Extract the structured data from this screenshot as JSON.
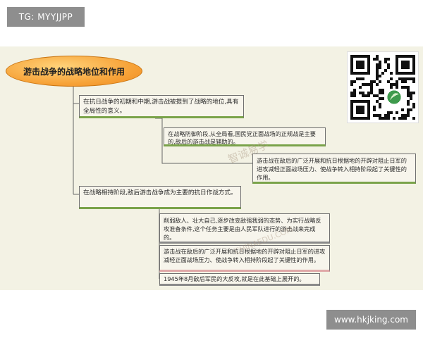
{
  "tags": {
    "top": "TG: MYYJJPP",
    "bottom": "www.hkjking.com"
  },
  "diagram": {
    "title": "游击战争的战略地位和作用",
    "nodes": [
      {
        "text": "在抗日战争的初期和中期,游击战被提到了战略的地位,具有全局性的意义。"
      },
      {
        "text": "在战略防御阶段,从全局看,国民党正面战场的正规战是主要的,敌后的游击战是辅助的。"
      },
      {
        "text": "游击战在敌后的广泛开展和抗日根据地的开辟对阻止日军的进攻减轻正面战场压力、使战争转入相持阶段起了关键性的作用。"
      },
      {
        "text": "在战略相持阶段,敌后游击战争成为主要的抗日作战方式。"
      },
      {
        "text": "削弱敌人、壮大自己,逐步改变敌强我弱的态势、为实行战略反攻准备条件,这个任务主要是由人民军队进行的游击战来完成的。"
      },
      {
        "text": "游击战在敌后的广泛开展和抗日根据地的开辟对阻止日军的进攻减轻正面战场压力、使战争转入相持阶段起了关键性的作用。"
      },
      {
        "text": "1945年8月敌后军民的大反攻,就是在此基础上展开的。"
      }
    ]
  },
  "watermark": {
    "line1": "智诚易学",
    "line2": "CHINAEDU.COM"
  }
}
